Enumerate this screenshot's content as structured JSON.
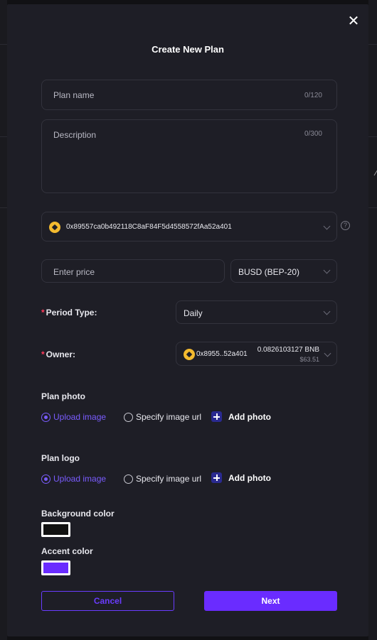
{
  "modal": {
    "title": "Create New Plan",
    "close_glyph": "✕"
  },
  "form": {
    "plan_name": {
      "placeholder": "Plan name",
      "counter": "0/120"
    },
    "description": {
      "placeholder": "Description",
      "counter": "0/300"
    },
    "wallet": {
      "address": "0x89557ca0b492118C8aF84F5d4558572fAa52a401",
      "icon": "bnb-coin-icon"
    },
    "price": {
      "placeholder": "Enter price"
    },
    "currency": {
      "selected": "BUSD (BEP-20)"
    },
    "period_type": {
      "label": "Period Type:",
      "required_mark": "*",
      "selected": "Daily"
    },
    "owner": {
      "label": "Owner:",
      "required_mark": "*",
      "address_short": "0x8955..52a401",
      "balance": "0.0826103127 BNB",
      "balance_usd": "$63.51"
    },
    "plan_photo": {
      "label": "Plan photo",
      "option_upload": "Upload image",
      "option_url": "Specify image url",
      "add_label": "Add photo",
      "selected": "upload"
    },
    "plan_logo": {
      "label": "Plan logo",
      "option_upload": "Upload image",
      "option_url": "Specify image url",
      "add_label": "Add photo",
      "selected": "upload"
    },
    "background_color": {
      "label": "Background color",
      "value": "#111111"
    },
    "accent_color": {
      "label": "Accent color",
      "value": "#6a2cff"
    }
  },
  "actions": {
    "cancel_label": "Cancel",
    "next_label": "Next"
  },
  "colors": {
    "accent": "#6a2cff",
    "required": "#ff3b5c",
    "coin": "#f3ba2f"
  }
}
